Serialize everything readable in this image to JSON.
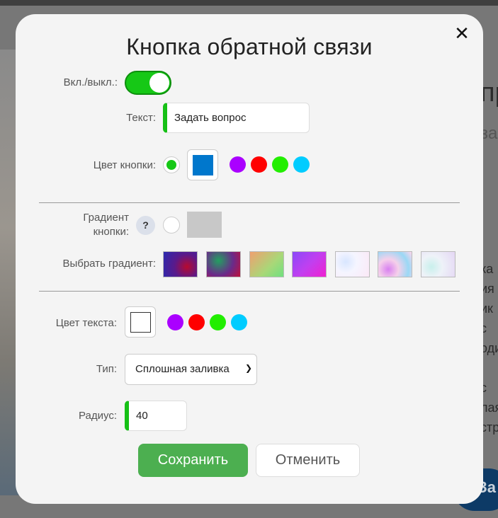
{
  "background": {
    "right_snippets": [
      "пр",
      "за",
      "ка",
      "ия",
      "ик",
      "с",
      "оди",
      "с",
      "лая",
      "стр"
    ],
    "floating_button_label": "За"
  },
  "modal": {
    "title": "Кнопка обратной связи",
    "close_symbol": "✕",
    "toggle": {
      "label": "Вкл./выкл.:",
      "state": "on"
    },
    "text_field": {
      "label": "Текст:",
      "value": "Задать вопрос"
    },
    "button_color": {
      "label": "Цвет кнопки:",
      "selected_mode": "solid",
      "current_color": "#0077cc",
      "presets": [
        "#aa00ff",
        "#ff0000",
        "#22ee00",
        "#00ccff"
      ]
    },
    "button_gradient": {
      "label": "Градиент кнопки:",
      "help_symbol": "?",
      "current_color": "#c8c8c8"
    },
    "gradient_picker": {
      "label": "Выбрать градиент:",
      "gradients": [
        "radial-gradient(circle at 70% 60%, #b80a2e 0%, #5a1a8a 45%, #2a2ab0 100%)",
        "radial-gradient(circle at 35% 35%, #22a060 0%, #6a2a8a 55%, #c0103a 100%)",
        "linear-gradient(135deg, #f0a070 0%, #a8d878 60%, #70e080 100%)",
        "linear-gradient(135deg, #8a4af8 0%, #c040f0 50%, #f020d0 100%)",
        "radial-gradient(circle at 30% 40%, #d8e6ff 0%, #f5f5ff 40%, #fbe8f6 100%)",
        "radial-gradient(circle at 30% 70%, #d880f0 0%, #f5d0ea 35%, #9ad8f5 70%, #ffd6ec 100%)",
        "radial-gradient(circle at 30% 60%, #c8f0ec 0%, #eef2f8 40%, #e4d6f4 100%)"
      ]
    },
    "text_color": {
      "label": "Цвет текста:",
      "current_color": "#ffffff",
      "presets": [
        "#aa00ff",
        "#ff0000",
        "#22ee00",
        "#00ccff"
      ]
    },
    "type_select": {
      "label": "Тип:",
      "value": "Сплошная заливка"
    },
    "radius": {
      "label": "Радиус:",
      "value": "40"
    },
    "save_label": "Сохранить",
    "cancel_label": "Отменить",
    "colors": {
      "accent_green": "#16c816",
      "save_green": "#4caf50"
    }
  }
}
